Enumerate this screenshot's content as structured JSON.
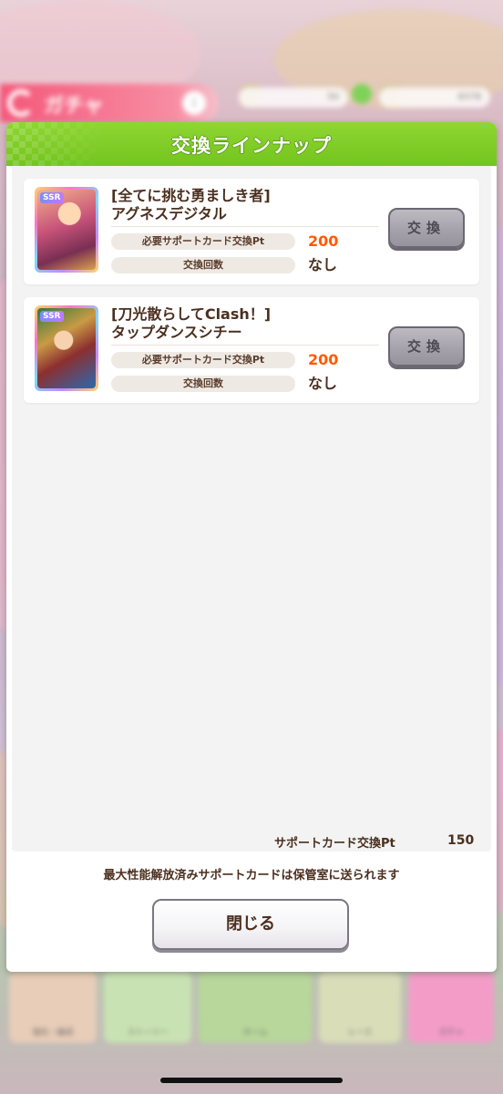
{
  "background": {
    "gacha_label": "ガチャ",
    "info_label": "i",
    "currency_1": "50",
    "currency_2": "8378",
    "menu_labels": [
      "強化・編成",
      "ストーリー",
      "ホーム",
      "レース",
      "ガチャ"
    ]
  },
  "modal": {
    "title": "交換ラインナップ",
    "items": [
      {
        "rarity": "SSR",
        "name_line1": "[全てに挑む勇ましき者]",
        "name_line2": "アグネスデジタル",
        "cost_label": "必要サポートカード交換Pt",
        "cost_value": "200",
        "count_label": "交換回数",
        "count_value": "なし",
        "button_label": "交換"
      },
      {
        "rarity": "SSR",
        "name_line1": "[刀光散らしてClash！]",
        "name_line2": "タップダンスシチー",
        "cost_label": "必要サポートカード交換Pt",
        "cost_value": "200",
        "count_label": "交換回数",
        "count_value": "なし",
        "button_label": "交換"
      }
    ],
    "points_label": "サポートカード交換Pt",
    "points_value": "150",
    "note": "最大性能解放済みサポートカードは保管室に送られます",
    "close_label": "閉じる"
  },
  "colors": {
    "header_green": "#7cc827",
    "cost_orange": "#ff5a00",
    "text_brown": "#4b2f1f"
  }
}
